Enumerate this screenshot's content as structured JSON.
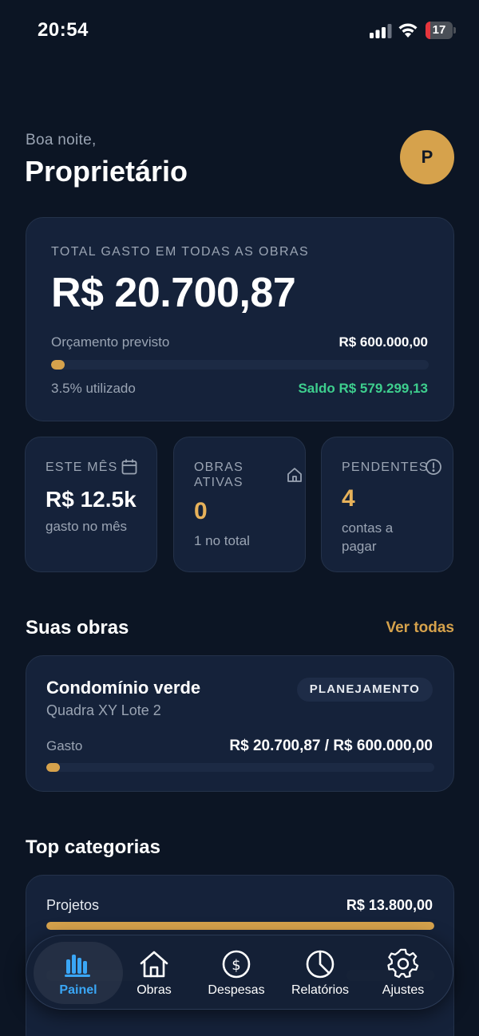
{
  "status_bar": {
    "time": "20:54",
    "battery_level": "17",
    "battery_fraction": 0.17,
    "icons": [
      "signal-icon",
      "wifi-icon",
      "battery-icon"
    ]
  },
  "header": {
    "greeting": "Boa noite,",
    "user_name": "Proprietário",
    "avatar_initial": "P"
  },
  "summary": {
    "label": "TOTAL GASTO EM TODAS AS OBRAS",
    "total": "R$ 20.700,87",
    "budget_label": "Orçamento previsto",
    "budget_value": "R$ 600.000,00",
    "usage_fraction": 0.035,
    "usage_text": "3.5% utilizado",
    "balance_text": "Saldo R$ 579.299,13"
  },
  "stats": {
    "month": {
      "label": "ESTE MÊS",
      "value": "R$ 12.5k",
      "sub": "gasto no mês",
      "icon": "calendar-icon"
    },
    "active": {
      "label_line1": "OBRAS",
      "label_line2": "ATIVAS",
      "value": "0",
      "sub": "1 no total",
      "icon": "home-icon"
    },
    "pending": {
      "label": "PENDENTES",
      "value": "4",
      "sub_line1": "contas a",
      "sub_line2": "pagar",
      "icon": "alert-circle-icon"
    }
  },
  "projects": {
    "title": "Suas obras",
    "see_all": "Ver todas",
    "items": [
      {
        "name": "Condomínio verde",
        "address": "Quadra XY Lote 2",
        "status": "PLANEJAMENTO",
        "spent_label": "Gasto",
        "spent_value": "R$ 20.700,87 / R$ 600.000,00",
        "spent_fraction": 0.035
      }
    ]
  },
  "categories": {
    "title": "Top categorias",
    "items": [
      {
        "name": "Projetos",
        "value": "R$ 13.800,00",
        "fraction": 1.0
      }
    ]
  },
  "nav": {
    "items": [
      {
        "label": "Painel",
        "icon": "bar-chart-icon",
        "active": true
      },
      {
        "label": "Obras",
        "icon": "home-icon",
        "active": false
      },
      {
        "label": "Despesas",
        "icon": "dollar-circle-icon",
        "active": false
      },
      {
        "label": "Relatórios",
        "icon": "pie-chart-icon",
        "active": false
      },
      {
        "label": "Ajustes",
        "icon": "gear-icon",
        "active": false
      }
    ]
  },
  "colors": {
    "background": "#0c1524",
    "card": "#15223a",
    "accent_gold": "#d6a24c",
    "success_green": "#3ecf8e",
    "active_blue": "#3aa6f5",
    "battery_low": "#e5353d"
  }
}
